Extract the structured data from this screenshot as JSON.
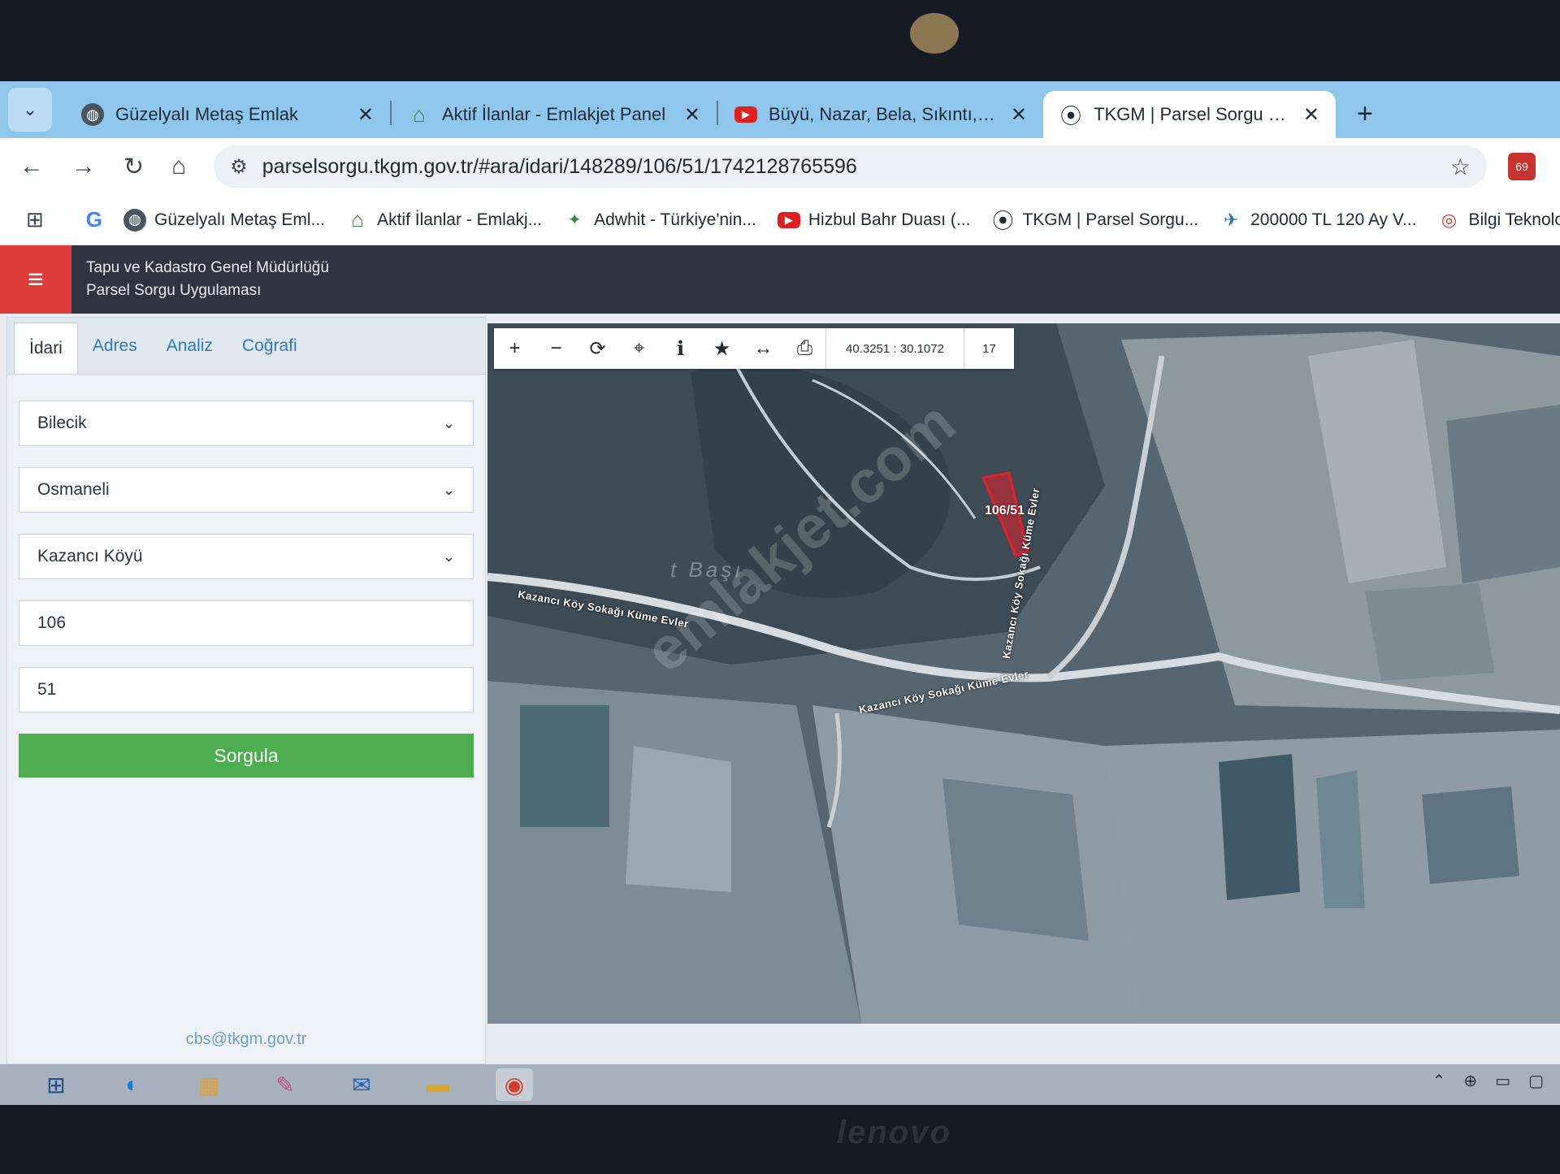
{
  "tabs": [
    {
      "title": "Güzelyalı Metaş Emlak",
      "icon": "globe-icon"
    },
    {
      "title": "Aktif İlanlar - Emlakjet Panel",
      "icon": "house-icon"
    },
    {
      "title": "Büyü, Nazar, Bela, Sıkıntı, Kıskan",
      "icon": "youtube-icon"
    },
    {
      "title": "TKGM | Parsel Sorgu Uygulaması",
      "icon": "map-pin-icon"
    }
  ],
  "address": {
    "url": "parselsorgu.tkgm.gov.tr/#ara/idari/148289/106/51/1742128765596"
  },
  "extension_badge": "69",
  "bookmarks": [
    {
      "label": "Güzelyalı Metaş Eml...",
      "icon": "globe-icon"
    },
    {
      "label": "Aktif İlanlar - Emlakj...",
      "icon": "house-icon"
    },
    {
      "label": "Adwhit - Türkiye'nin...",
      "icon": "adwhit-icon"
    },
    {
      "label": "Hizbul Bahr Duası (...",
      "icon": "youtube-icon"
    },
    {
      "label": "TKGM | Parsel Sorgu...",
      "icon": "map-pin-icon"
    },
    {
      "label": "200000 TL 120 Ay V...",
      "icon": "bank-icon"
    },
    {
      "label": "Bilgi Teknolojileri ve...",
      "icon": "btk-icon"
    }
  ],
  "app": {
    "title_line1": "Tapu ve Kadastro Genel Müdürlüğü",
    "title_line2": "Parsel Sorgu Uygulaması"
  },
  "sidebar": {
    "tabs": [
      "İdari",
      "Adres",
      "Analiz",
      "Coğrafi"
    ],
    "active_tab": "İdari",
    "il": "Bilecik",
    "ilce": "Osmaneli",
    "mahalle": "Kazancı Köyü",
    "ada": "106",
    "parsel": "51",
    "submit_label": "Sorgula",
    "footer_email": "cbs@tkgm.gov.tr"
  },
  "map": {
    "coordinates": "40.3251 : 30.1072",
    "zoom_level": "17",
    "parcel_label": "106/51",
    "road_labels": [
      "Kazancı Köy Sokağı Küme Evler",
      "Kazancı Köy Sokağı Küme Evler",
      "Kazancı Köy Sokağı Küme Evler"
    ],
    "watermark": "emlakjet.com",
    "place_label": "t Başı",
    "parcel_color": "#e0202a"
  },
  "taskbar": [
    "windows-start-icon",
    "edge-icon",
    "store-icon",
    "paint-icon",
    "outlook-icon",
    "file-explorer-icon",
    "chrome-icon"
  ],
  "device_brand": "lenovo"
}
